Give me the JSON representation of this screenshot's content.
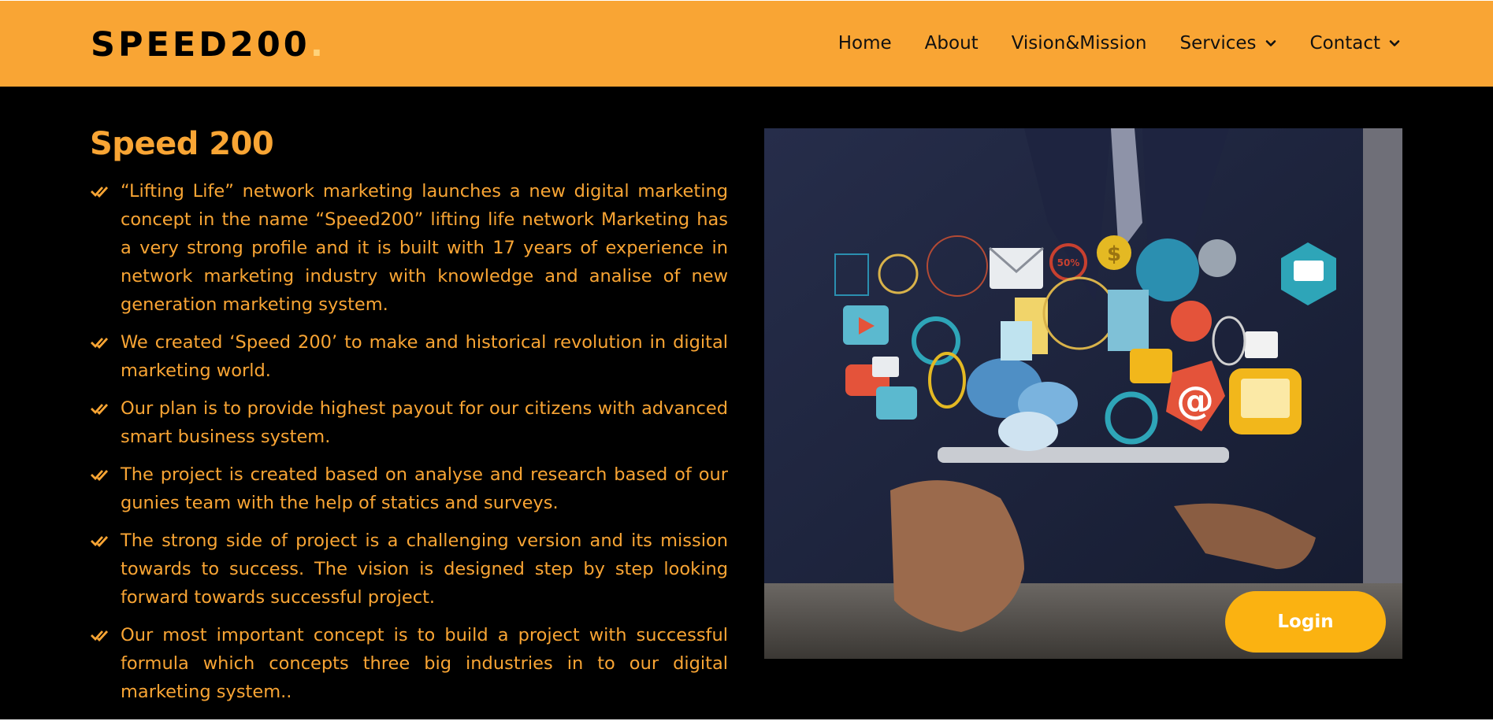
{
  "header": {
    "logo": "SPEED200",
    "logo_dot": ".",
    "nav": [
      {
        "label": "Home",
        "dropdown": false
      },
      {
        "label": "About",
        "dropdown": false
      },
      {
        "label": "Vision&Mission",
        "dropdown": false
      },
      {
        "label": "Services",
        "dropdown": true
      },
      {
        "label": "Contact",
        "dropdown": true
      }
    ]
  },
  "main": {
    "title": "Speed 200",
    "points": [
      "“Lifting Life” network marketing launches a new digital marketing concept in the name “Speed200” lifting life network Marketing has a very strong profile and it is built with 17 years of experience in network marketing industry with knowledge and analise of new generation marketing system.",
      "We created ‘Speed 200’ to make and historical revolution in digital marketing world.",
      "Our plan is to provide highest payout for our citizens with advanced smart business system.",
      "The project is created based on analyse and research based of our gunies team with the help of statics and surveys.",
      "The strong side of project is a challenging version and its mission towards to success. The vision is designed step by step looking forward towards successful project.",
      "Our most important concept is to build a project with successful formula which concepts three big industries in to our digital marketing system.."
    ],
    "hero_icon_labels": [
      "50%",
      "$",
      "@"
    ],
    "login_label": "Login"
  },
  "colors": {
    "accent": "#f9a534",
    "login": "#fbb211",
    "background": "#000000"
  }
}
